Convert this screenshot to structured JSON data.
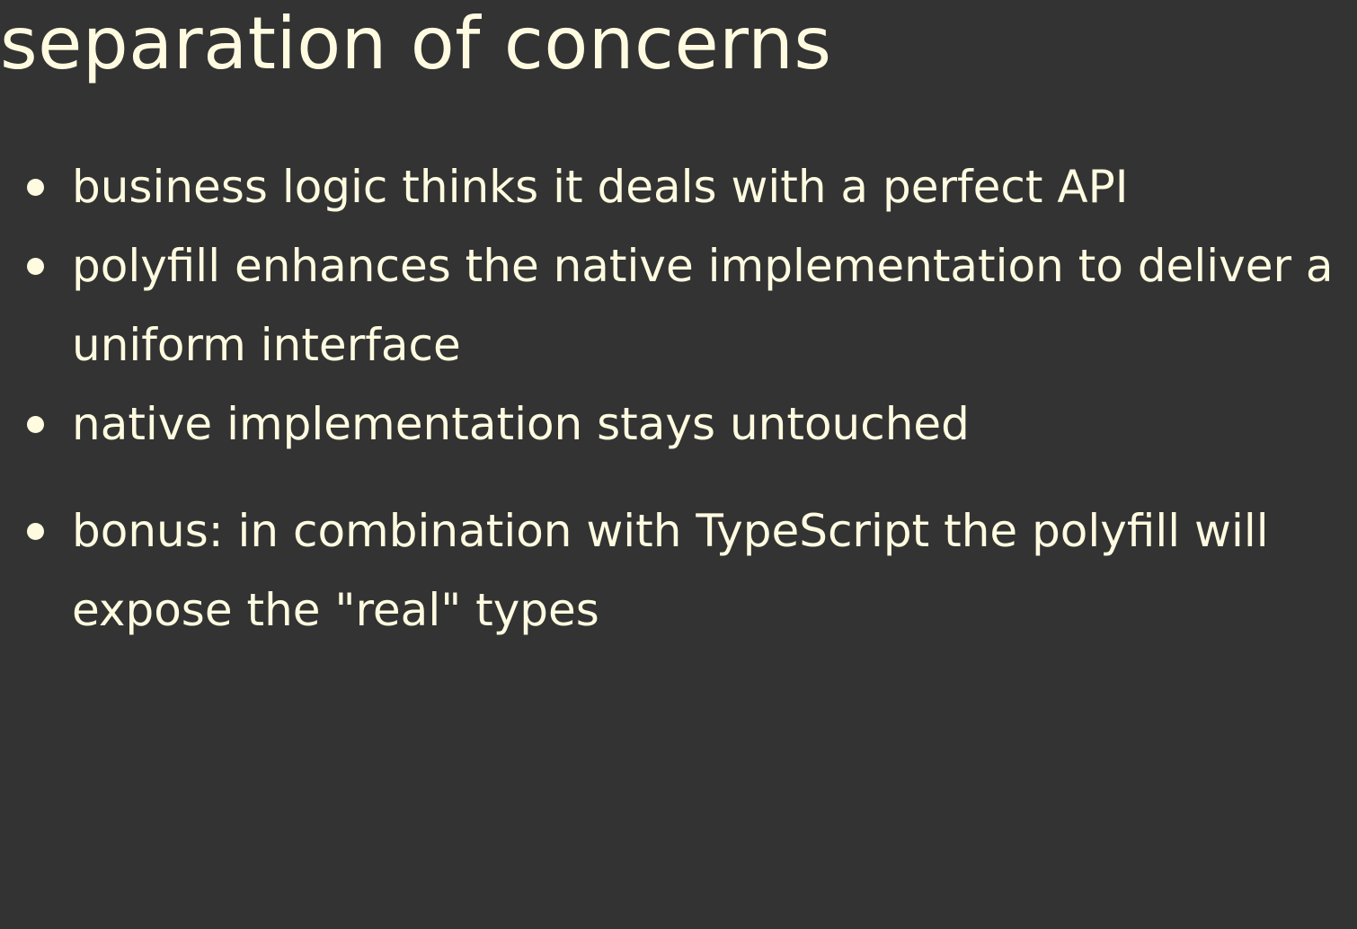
{
  "slide": {
    "title": "separation of concerns",
    "bullets": [
      "business logic thinks it deals with a perfect API",
      "polyfill enhances the native implementation to deliver a uniform interface",
      "native implementation stays untouched",
      "bonus: in combination with TypeScript the polyfill will expose the \"real\" types"
    ]
  },
  "colors": {
    "background": "#333333",
    "text": "#fffbe0"
  }
}
